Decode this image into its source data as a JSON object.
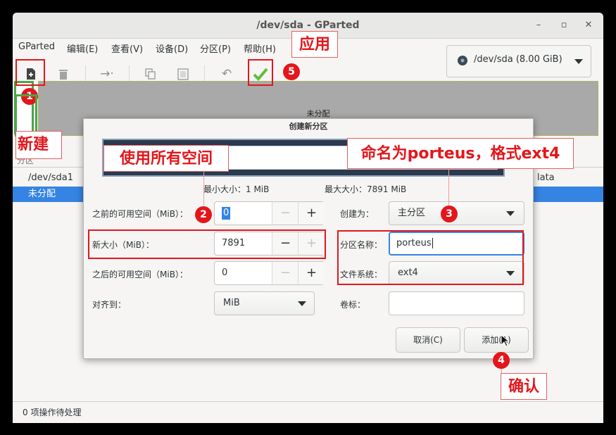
{
  "window": {
    "title": "/dev/sda - GParted",
    "minimize": "–",
    "maximize": "▫",
    "close": "✕"
  },
  "menu": [
    "GParted",
    "编辑(E)",
    "查看(V)",
    "设备(D)",
    "分区(P)",
    "帮助(H)"
  ],
  "device": {
    "label": "/dev/sda (8.00 GiB)"
  },
  "graph": {
    "unallocated_label": "未分配"
  },
  "list": {
    "header_partition": "分区",
    "rows": [
      {
        "name": "/dev/sda1",
        "extra": "lata"
      },
      {
        "name": "未分配"
      }
    ]
  },
  "status": {
    "text": "0 项操作待处理"
  },
  "dialog": {
    "title": "创建新分区",
    "min_size": "最小大小：1 MiB",
    "max_size": "最大大小：7891 MiB",
    "free_before": {
      "label": "之前的可用空间（MiB）：",
      "value": "0"
    },
    "new_size": {
      "label": "新大小（MiB）：",
      "value": "7891"
    },
    "free_after": {
      "label": "之后的可用空间（MiB）：",
      "value": "0"
    },
    "align": {
      "label": "对齐到：",
      "value": "MiB"
    },
    "create_as": {
      "label": "创建为：",
      "value": "主分区"
    },
    "part_name": {
      "label": "分区名称：",
      "value": "porteus"
    },
    "filesystem": {
      "label": "文件系统：",
      "value": "ext4"
    },
    "volume_label": {
      "label": "卷标：",
      "value": ""
    },
    "cancel": "取消(C)",
    "add": "添加(A)",
    "minus": "−",
    "plus": "+"
  },
  "annotations": {
    "new": "新建",
    "apply": "应用",
    "use_all": "使用所有空间",
    "name_fs": "命名为porteus，格式ext4",
    "confirm": "确认",
    "n1": "1",
    "n2": "2",
    "n3": "3",
    "n4": "4",
    "n5": "5"
  },
  "colors": {
    "annotation": "#e3161b",
    "selection": "#3584e4",
    "apply_check": "#5bbf3a"
  }
}
